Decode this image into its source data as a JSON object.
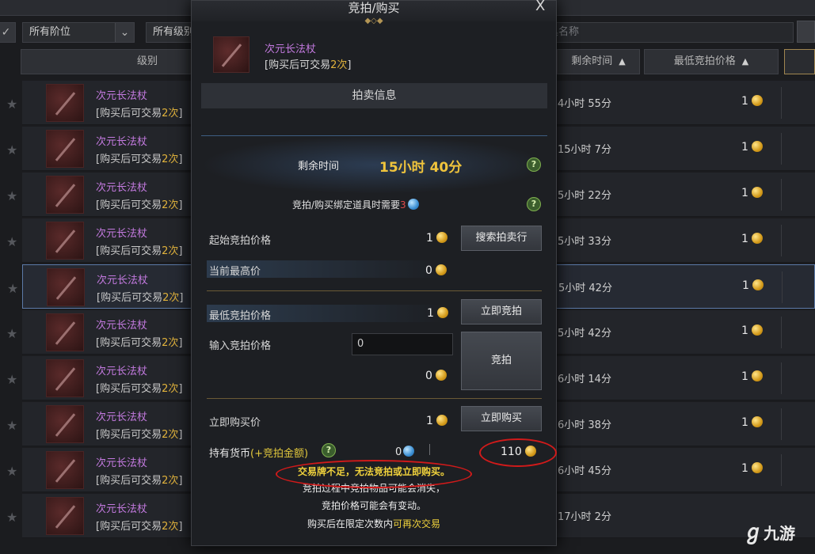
{
  "filters": {
    "rank": "所有阶位",
    "level": "所有级别",
    "search_placeholder": "道具名称"
  },
  "columns": {
    "level": "级别",
    "time_left": "剩余时间",
    "min_bid": "最低竞拍价格"
  },
  "rows": [
    {
      "name": "次元长法杖",
      "sub_prefix": "[购买后可交易",
      "sub_count": "2次",
      "sub_suffix": "]",
      "time": "4小时 55分",
      "price": "1"
    },
    {
      "name": "次元长法杖",
      "sub_prefix": "[购买后可交易",
      "sub_count": "2次",
      "sub_suffix": "]",
      "time": "15小时 7分",
      "price": "1"
    },
    {
      "name": "次元长法杖",
      "sub_prefix": "[购买后可交易",
      "sub_count": "2次",
      "sub_suffix": "]",
      "time": "5小时 22分",
      "price": "1"
    },
    {
      "name": "次元长法杖",
      "sub_prefix": "[购买后可交易",
      "sub_count": "2次",
      "sub_suffix": "]",
      "time": "5小时 33分",
      "price": "1"
    },
    {
      "name": "次元长法杖",
      "sub_prefix": "[购买后可交易",
      "sub_count": "2次",
      "sub_suffix": "]",
      "time": "5小时 42分",
      "price": "1"
    },
    {
      "name": "次元长法杖",
      "sub_prefix": "[购买后可交易",
      "sub_count": "2次",
      "sub_suffix": "]",
      "time": "5小时 42分",
      "price": "1"
    },
    {
      "name": "次元长法杖",
      "sub_prefix": "[购买后可交易",
      "sub_count": "2次",
      "sub_suffix": "]",
      "time": "6小时 14分",
      "price": "1"
    },
    {
      "name": "次元长法杖",
      "sub_prefix": "[购买后可交易",
      "sub_count": "2次",
      "sub_suffix": "]",
      "time": "6小时 38分",
      "price": "1"
    },
    {
      "name": "次元长法杖",
      "sub_prefix": "[购买后可交易",
      "sub_count": "2次",
      "sub_suffix": "]",
      "time": "6小时 45分",
      "price": "1"
    },
    {
      "name": "次元长法杖",
      "sub_prefix": "[购买后可交易",
      "sub_count": "2次",
      "sub_suffix": "]",
      "time": "17小时 2分",
      "price": ""
    }
  ],
  "modal": {
    "title": "竞拍/购买",
    "close": "X",
    "item_name": "次元长法杖",
    "item_sub_prefix": "[购买后可交易",
    "item_sub_count": "2次",
    "item_sub_suffix": "]",
    "section": "拍卖信息",
    "remain_label": "剩余时间",
    "remain_value": "15小时 40分",
    "bind_note": "竞拍/购买绑定道具时需要",
    "bind_count": "3",
    "start_label": "起始竞拍价格",
    "start_value": "1",
    "search_button": "搜索拍卖行",
    "current_label": "当前最高价",
    "current_value": "0",
    "min_label": "最低竞拍价格",
    "min_value": "1",
    "bid_now_button": "立即竞拍",
    "input_label": "输入竞拍价格",
    "input_value": "0",
    "input_total": "0",
    "bid_button": "竞拍",
    "buyout_label": "立即购买价",
    "buyout_value": "1",
    "buyout_button": "立即购买",
    "hold_label": "持有货币",
    "hold_extra": "(+竞拍金额)",
    "hold_blue": "0",
    "hold_gold": "110",
    "warn_1": "交易牌不足，无法竞拍或立即购买。",
    "warn_2": "竞拍过程中竞拍物品可能会消失，",
    "warn_3": "竞拍价格可能会有变动。",
    "warn_4a": "购买后在限定次数内",
    "warn_4b": "可再次交易"
  },
  "watermark": {
    "text": "九游"
  },
  "colors": {
    "accent_gold": "#f0c43c",
    "item_purple": "#c47ae0",
    "annotation_red": "#d11a1a"
  }
}
